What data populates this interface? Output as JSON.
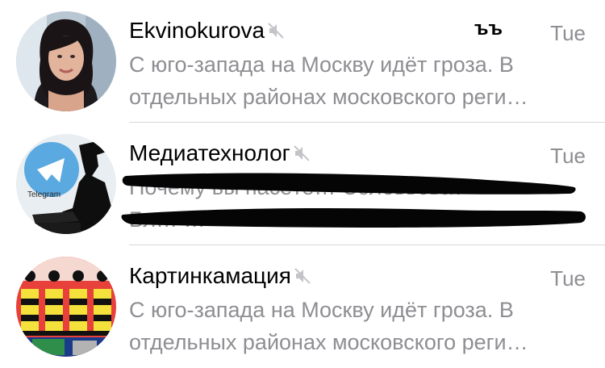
{
  "chats": [
    {
      "name": "Ekvinokurova",
      "time": "Tue",
      "preview_line1": "С юго-запада на Москву идёт гроза. В",
      "preview_line2": "отдельных районах московского реги…",
      "muted": true,
      "avatar_icon": "person-photo-avatar"
    },
    {
      "name": "Медиатехнолог",
      "time": "Tue",
      "preview_line1": "Почему вы пасёте… Соловьёва?",
      "preview_line2": "Бл… …",
      "muted": true,
      "redacted": true,
      "avatar_icon": "telegram-silhouette-avatar"
    },
    {
      "name": "Картинкамация",
      "time": "Tue",
      "preview_line1": "С юго-запада на Москву идёт гроза. В",
      "preview_line2": "отдельных районах московского реги…",
      "muted": true,
      "avatar_icon": "art-collage-avatar"
    }
  ],
  "overlay_mark": "ъъ",
  "colors": {
    "text_primary": "#000000",
    "text_secondary": "#8e8e93",
    "divider": "#d8d8d8",
    "redaction": "#000000"
  }
}
